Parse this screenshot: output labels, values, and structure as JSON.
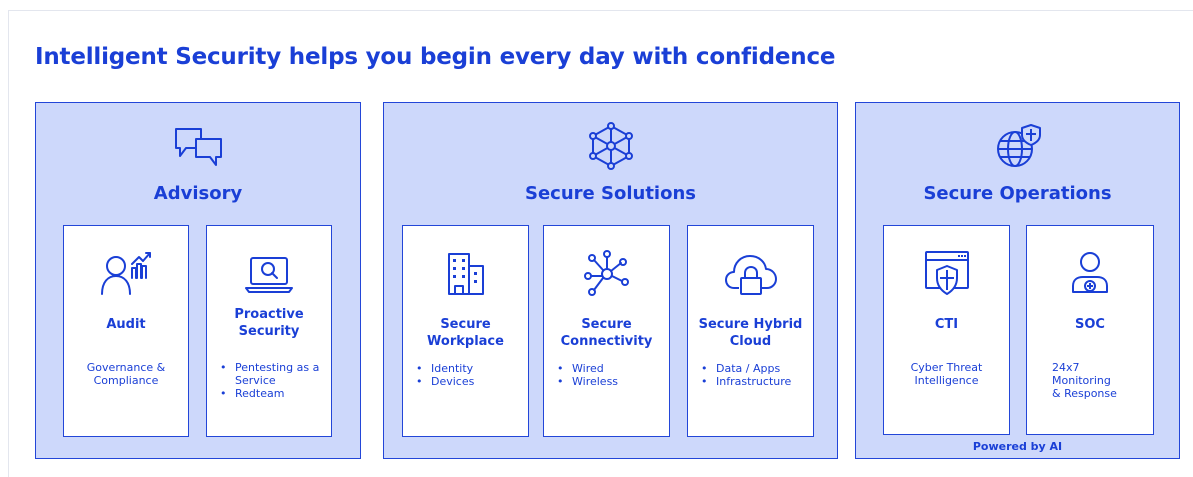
{
  "title": "Intelligent Security helps you begin every day with confidence",
  "colors": {
    "accent": "#1a3fd6",
    "panel_fill": "#cdd8fb",
    "card_fill": "#ffffff"
  },
  "pillars": [
    {
      "title": "Advisory",
      "icon": "chat-bubbles-icon",
      "cards": [
        {
          "title": "Audit",
          "icon": "person-chart-icon",
          "description": "Governance &\nCompliance"
        },
        {
          "title": "Proactive Security",
          "icon": "laptop-search-icon",
          "bullets": [
            "Pentesting as a Service",
            "Redteam"
          ]
        }
      ]
    },
    {
      "title": "Secure Solutions",
      "icon": "network-hexagon-icon",
      "cards": [
        {
          "title": "Secure Workplace",
          "icon": "office-building-icon",
          "bullets": [
            "Identity",
            "Devices"
          ]
        },
        {
          "title": "Secure Connectivity",
          "icon": "hub-network-icon",
          "bullets": [
            "Wired",
            "Wireless"
          ]
        },
        {
          "title": "Secure Hybrid Cloud",
          "icon": "cloud-lock-icon",
          "bullets": [
            "Data / Apps",
            "Infrastructure"
          ]
        }
      ]
    },
    {
      "title": "Secure Operations",
      "icon": "globe-shield-icon",
      "cards": [
        {
          "title": "CTI",
          "icon": "browser-shield-icon",
          "description": "Cyber Threat\nIntelligence"
        },
        {
          "title": "SOC",
          "icon": "operator-icon",
          "description": "24x7\nMonitoring\n& Response"
        }
      ],
      "footnote": "Powered by AI"
    }
  ]
}
